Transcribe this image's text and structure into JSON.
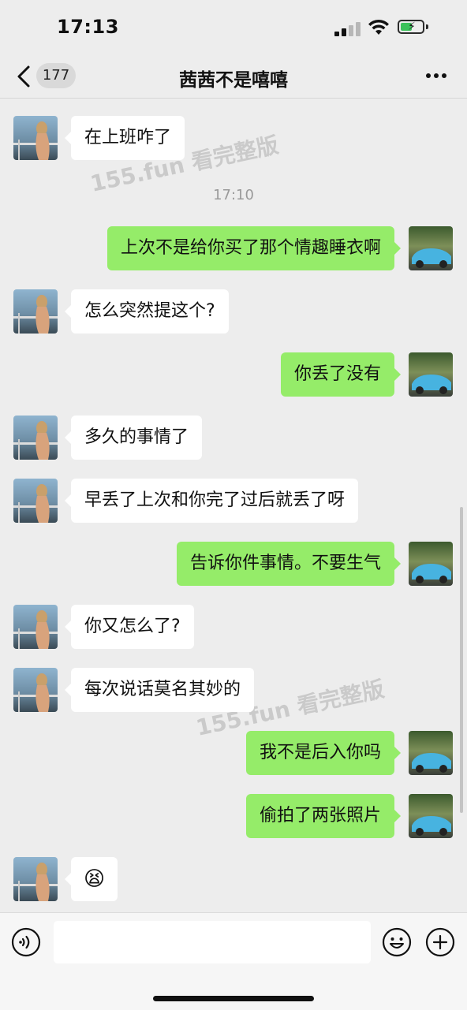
{
  "status_bar": {
    "time": "17:13"
  },
  "header": {
    "unread_count": "177",
    "contact_name": "茜茜不是嘻嘻"
  },
  "watermark_text": "155.fun 看完整版",
  "timestamp": "17:10",
  "messages": [
    {
      "side": "in",
      "text": "在上班咋了"
    },
    {
      "side": "out",
      "text": "上次不是给你买了那个情趣睡衣啊"
    },
    {
      "side": "in",
      "text": "怎么突然提这个?"
    },
    {
      "side": "out",
      "text": "你丢了没有"
    },
    {
      "side": "in",
      "text": "多久的事情了"
    },
    {
      "side": "in",
      "text": "早丢了上次和你完了过后就丢了呀"
    },
    {
      "side": "out",
      "text": "告诉你件事情。不要生气"
    },
    {
      "side": "in",
      "text": "你又怎么了?"
    },
    {
      "side": "in",
      "text": "每次说话莫名其妙的"
    },
    {
      "side": "out",
      "text": "我不是后入你吗"
    },
    {
      "side": "out",
      "text": "偷拍了两张照片"
    },
    {
      "side": "in",
      "text": "😫"
    }
  ],
  "input_bar": {
    "draft": ""
  },
  "icons": {
    "back": "chevron-left-icon",
    "more": "more-dots-icon",
    "voice": "voice-icon",
    "emoji": "emoji-icon",
    "plus": "plus-icon"
  },
  "colors": {
    "background": "#ededed",
    "incoming_bubble": "#ffffff",
    "outgoing_bubble": "#95ec69",
    "timestamp": "#9a9a9a"
  }
}
